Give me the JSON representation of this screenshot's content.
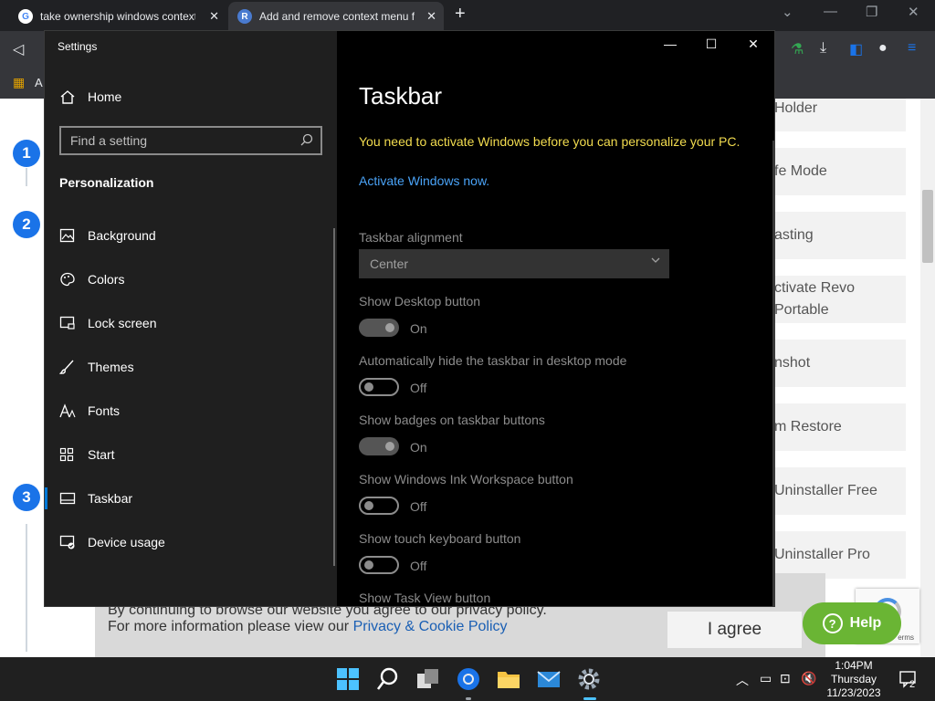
{
  "browser": {
    "tabs": [
      {
        "title": "take ownership windows context",
        "icon": "google-icon"
      },
      {
        "title": "Add and remove context menu f",
        "icon": "site-icon"
      }
    ],
    "bookmark_letter": "A"
  },
  "webpage": {
    "steps": [
      "1",
      "2",
      "3"
    ],
    "sidebar_items": [
      "Holder",
      "fe Mode",
      "asting",
      "ctivate Revo\nPortable",
      "nshot",
      "m Restore",
      "Uninstaller Free",
      "Uninstaller Pro"
    ],
    "cookie": {
      "line1": "By continuing to browse our website you agree to our privacy policy.",
      "line2_prefix": "For more information please view our ",
      "line2_link": "Privacy & Cookie Policy",
      "agree": "I agree"
    },
    "help_label": "Help",
    "recaptcha_text": "erms"
  },
  "settings": {
    "window_title": "Settings",
    "home_label": "Home",
    "search_placeholder": "Find a setting",
    "section_heading": "Personalization",
    "nav_items": [
      {
        "label": "Background",
        "icon": "picture-icon"
      },
      {
        "label": "Colors",
        "icon": "palette-icon"
      },
      {
        "label": "Lock screen",
        "icon": "lock-screen-icon"
      },
      {
        "label": "Themes",
        "icon": "brush-icon"
      },
      {
        "label": "Fonts",
        "icon": "fonts-icon"
      },
      {
        "label": "Start",
        "icon": "start-icon"
      },
      {
        "label": "Taskbar",
        "icon": "taskbar-icon",
        "selected": true
      },
      {
        "label": "Device usage",
        "icon": "device-usage-icon"
      }
    ],
    "page_title": "Taskbar",
    "activate_message": "You need to activate Windows before you can personalize your PC.",
    "activate_link": "Activate Windows now.",
    "alignment_label": "Taskbar alignment",
    "alignment_value": "Center",
    "toggles": [
      {
        "label": "Show Desktop button",
        "state": "On"
      },
      {
        "label": "Automatically hide the taskbar in desktop mode",
        "state": "Off"
      },
      {
        "label": "Show badges on taskbar buttons",
        "state": "On"
      },
      {
        "label": "Show Windows Ink Workspace button",
        "state": "Off"
      },
      {
        "label": "Show touch keyboard button",
        "state": "Off"
      },
      {
        "label": "Show Task View button",
        "state": ""
      }
    ]
  },
  "taskbar": {
    "time": "1:04PM",
    "day": "Thursday",
    "date": "11/23/2023",
    "notifications": "2"
  },
  "colors": {
    "accent": "#0078d7",
    "warning": "#f2dc4f",
    "link": "#4aa3f7",
    "help_green": "#6ab534"
  }
}
